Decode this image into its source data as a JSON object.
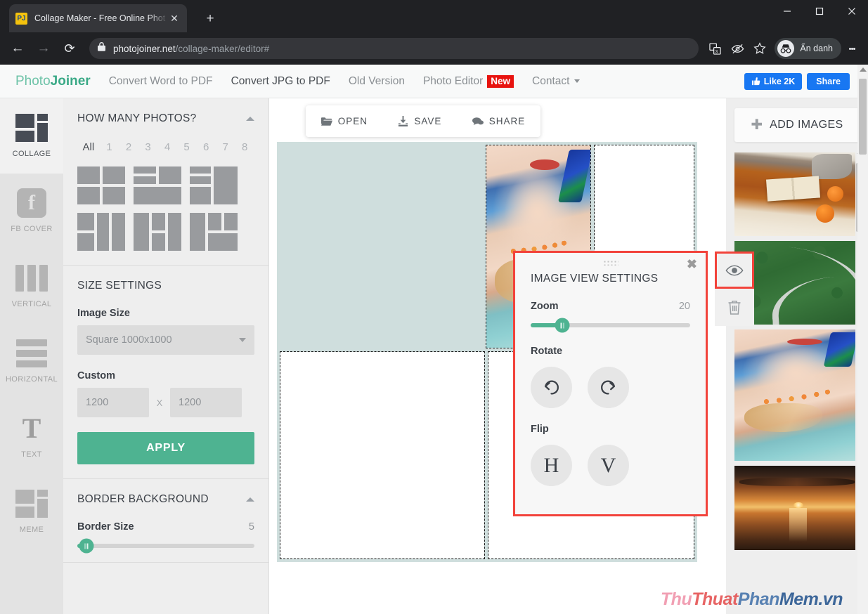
{
  "browser": {
    "tab": {
      "favicon_text": "PJ",
      "title": "Collage Maker - Free Online Phot",
      "close_icon": "✕"
    },
    "newtab_label": "+",
    "nav": {
      "back_icon": "←",
      "forward_icon": "→",
      "reload_icon": "⟳"
    },
    "omnibox": {
      "lock_icon": "lock-icon",
      "domain": "photojoiner.net",
      "path": "/collage-maker/editor#"
    },
    "toolbar_icons": [
      "translate-icon",
      "eye-slash-icon",
      "star-icon"
    ],
    "incognito_label": "Ẩn danh",
    "menu_icon": "kebab-menu-icon"
  },
  "site_header": {
    "logo_part1": "Photo",
    "logo_part2": "Joiner",
    "nav_items": [
      {
        "label": "Convert Word to PDF",
        "dark": false
      },
      {
        "label": "Convert JPG to PDF",
        "dark": true
      },
      {
        "label": "Old Version",
        "dark": false
      },
      {
        "label": "Photo Editor",
        "dark": false,
        "badge": "New"
      },
      {
        "label": "Contact",
        "dark": false,
        "caret": true
      }
    ],
    "facebook": {
      "like_label": "Like 2K",
      "share_label": "Share",
      "color": "#1877f2"
    }
  },
  "rail": {
    "items": [
      {
        "label": "COLLAGE",
        "icon": "collage-icon",
        "active": true
      },
      {
        "label": "FB COVER",
        "icon": "facebook-icon",
        "active": false
      },
      {
        "label": "VERTICAL",
        "icon": "vertical-layout-icon",
        "active": false
      },
      {
        "label": "HORIZONTAL",
        "icon": "horizontal-layout-icon",
        "active": false
      },
      {
        "label": "TEXT",
        "icon": "text-icon",
        "active": false
      },
      {
        "label": "MEME",
        "icon": "meme-icon",
        "active": false
      }
    ]
  },
  "settings": {
    "how_many": {
      "title": "HOW MANY PHOTOS?",
      "collapse_icon": "chevron-up-icon",
      "counts": [
        "All",
        "1",
        "2",
        "3",
        "4",
        "5",
        "6",
        "7",
        "8"
      ],
      "selected_count": "All"
    },
    "size": {
      "title": "SIZE SETTINGS",
      "image_size_label": "Image Size",
      "image_size_value": "Square 1000x1000",
      "custom_label": "Custom",
      "custom_width": "1200",
      "custom_height": "1200",
      "x_separator": "X",
      "apply_label": "APPLY"
    },
    "border": {
      "title": "BORDER BACKGROUND",
      "collapse_icon": "chevron-up-icon",
      "border_size_label": "Border Size",
      "border_size_value": "5",
      "border_size_percent": 5
    }
  },
  "canvas_toolbar": {
    "open_label": "OPEN",
    "save_label": "SAVE",
    "share_label": "SHARE",
    "open_icon": "folder-open-icon",
    "save_icon": "download-icon",
    "share_icon": "comment-icon"
  },
  "cell_tools": {
    "eye_icon": "eye-icon",
    "trash_icon": "trash-icon",
    "highlight_color": "#f2433b"
  },
  "dialog": {
    "title": "IMAGE VIEW SETTINGS",
    "close_icon": "✖",
    "grip_icon": "drag-grip-icon",
    "zoom_label": "Zoom",
    "zoom_value": "20",
    "zoom_percent": 20,
    "rotate_label": "Rotate",
    "rotate_left_icon": "rotate-left-icon",
    "rotate_right_icon": "rotate-right-icon",
    "flip_label": "Flip",
    "flip_h_label": "H",
    "flip_v_label": "V",
    "border_color": "#f2433b"
  },
  "right_panel": {
    "add_images_label": "ADD IMAGES",
    "add_icon": "plus-icon",
    "thumbnails": [
      {
        "name": "autumn-book-pumpkins",
        "style": "book"
      },
      {
        "name": "aerial-forest-road",
        "style": "forest"
      },
      {
        "name": "woman-portrait-pool",
        "style": "portrait"
      },
      {
        "name": "ocean-sunset",
        "style": "sunset"
      }
    ],
    "scroll_up_icon": "scroll-up-icon"
  },
  "canvas": {
    "expand_icon": "chevron-right-icon",
    "background_color": "#cfdedd"
  },
  "watermark": {
    "part1": "Thu",
    "part2": "Thuat",
    "part3": "Phan",
    "part4": "Mem.vn"
  }
}
